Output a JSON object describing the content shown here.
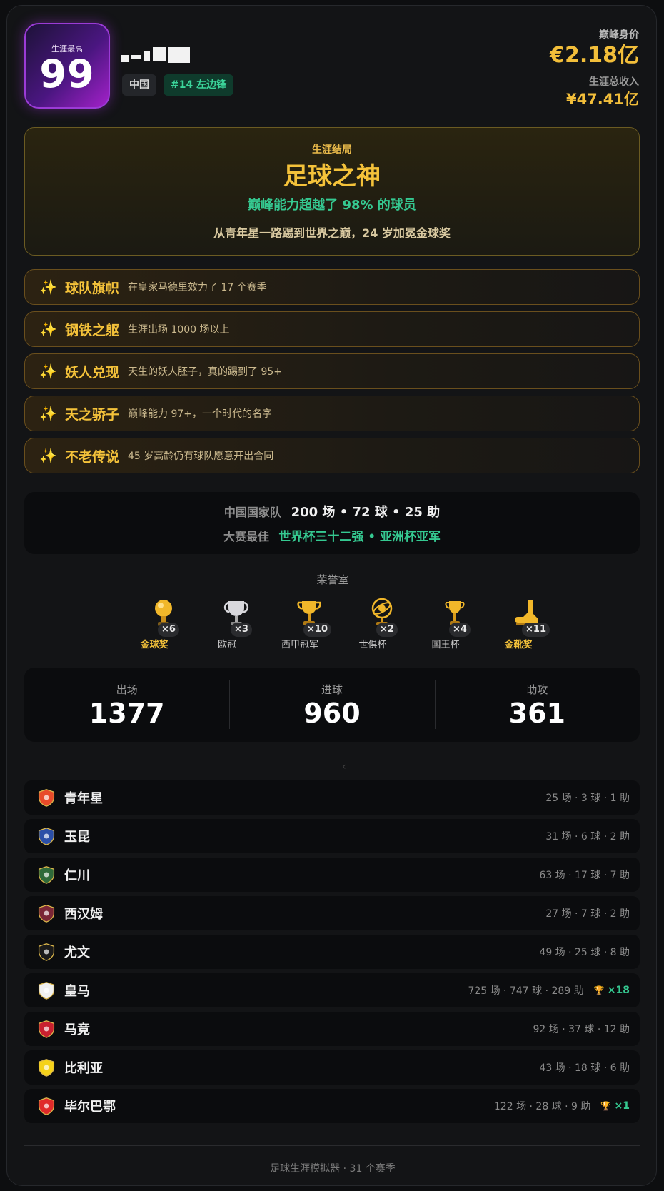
{
  "header": {
    "rating_label": "生涯最高",
    "rating_value": "99",
    "country": "中国",
    "position": "#14 左边锋",
    "peak_value_label": "巅峰身价",
    "peak_value": "€2.18亿",
    "income_label": "生涯总收入",
    "income_value": "¥47.41亿"
  },
  "ending": {
    "label": "生涯结局",
    "title": "足球之神",
    "percentile": "巅峰能力超越了 98% 的球员",
    "description": "从青年星一路踢到世界之巅，24 岁加冕金球奖"
  },
  "achievements": [
    {
      "name": "球队旗帜",
      "text": "在皇家马德里效力了 17 个赛季"
    },
    {
      "name": "钢铁之躯",
      "text": "生涯出场 1000 场以上"
    },
    {
      "name": "妖人兑现",
      "text": "天生的妖人胚子，真的踢到了 95+"
    },
    {
      "name": "天之骄子",
      "text": "巅峰能力 97+，一个时代的名字"
    },
    {
      "name": "不老传说",
      "text": "45 岁高龄仍有球队愿意开出合同"
    }
  ],
  "national": {
    "team_label": "中国国家队",
    "team_stats": "200 场 • 72 球 • 25 助",
    "best_label": "大赛最佳",
    "best_value": "世界杯三十二强 • 亚洲杯亚军"
  },
  "honors": {
    "title": "荣誉室",
    "items": [
      {
        "name": "金球奖",
        "count": "×6",
        "icon": "golden-ball-icon"
      },
      {
        "name": "欧冠",
        "count": "×3",
        "icon": "silver-trophy-icon"
      },
      {
        "name": "西甲冠军",
        "count": "×10",
        "icon": "gold-cup-icon"
      },
      {
        "name": "世俱杯",
        "count": "×2",
        "icon": "globe-trophy-icon"
      },
      {
        "name": "国王杯",
        "count": "×4",
        "icon": "small-cup-icon"
      },
      {
        "name": "金靴奖",
        "count": "×11",
        "icon": "golden-boot-icon"
      }
    ]
  },
  "stats": [
    {
      "label": "出场",
      "value": "1377"
    },
    {
      "label": "进球",
      "value": "960"
    },
    {
      "label": "助攻",
      "value": "361"
    }
  ],
  "clubs": [
    {
      "name": "青年星",
      "stats": "25 场 · 3 球 · 1 助",
      "trophies": "",
      "color": "#e84a2a"
    },
    {
      "name": "玉昆",
      "stats": "31 场 · 6 球 · 2 助",
      "trophies": "",
      "color": "#2b4fa8"
    },
    {
      "name": "仁川",
      "stats": "63 场 · 17 球 · 7 助",
      "trophies": "",
      "color": "#2f6a3a"
    },
    {
      "name": "西汉姆",
      "stats": "27 场 · 7 球 · 2 助",
      "trophies": "",
      "color": "#7a2636"
    },
    {
      "name": "尤文",
      "stats": "49 场 · 25 球 · 8 助",
      "trophies": "",
      "color": "#1a1a1a"
    },
    {
      "name": "皇马",
      "stats": "725 场 · 747 球 · 289 助",
      "trophies": "×18",
      "color": "#f0f0f0"
    },
    {
      "name": "马竞",
      "stats": "92 场 · 37 球 · 12 助",
      "trophies": "",
      "color": "#c8202f"
    },
    {
      "name": "比利亚",
      "stats": "43 场 · 18 球 · 6 助",
      "trophies": "",
      "color": "#f5d21a"
    },
    {
      "name": "毕尔巴鄂",
      "stats": "122 场 · 28 球 · 9 助",
      "trophies": "×1",
      "color": "#e02a2a"
    }
  ],
  "footer": "足球生涯模拟器 · 31 个赛季",
  "colors": {
    "gold": "#f4c23a",
    "green": "#35c991",
    "purple": "#a321c9"
  }
}
